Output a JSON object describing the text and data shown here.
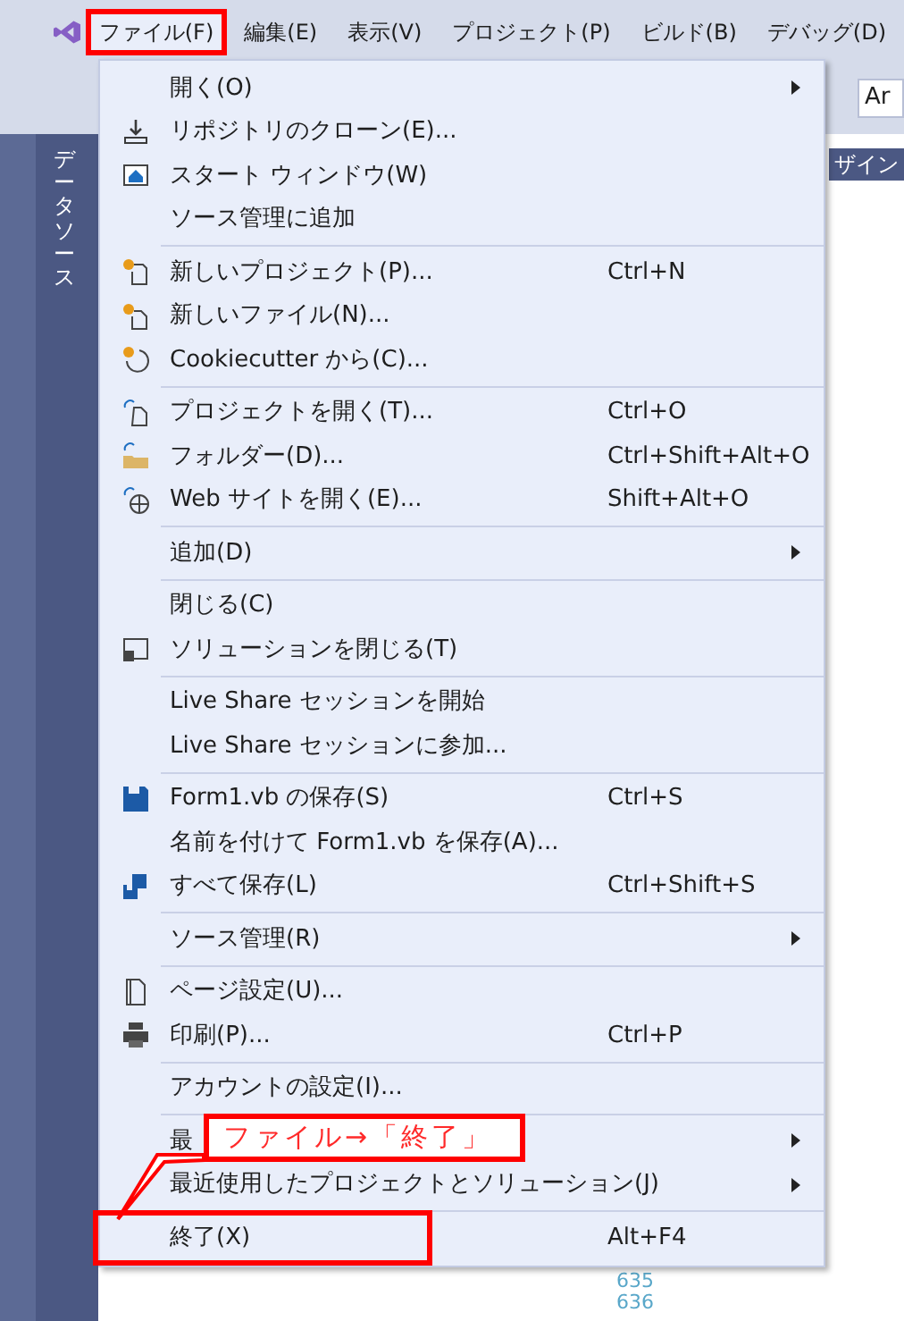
{
  "menubar": [
    {
      "label": "ファイル(F)",
      "highlighted": true
    },
    {
      "label": "編集(E)",
      "highlighted": false
    },
    {
      "label": "表示(V)",
      "highlighted": false
    },
    {
      "label": "プロジェクト(P)",
      "highlighted": false
    },
    {
      "label": "ビルド(B)",
      "highlighted": false
    },
    {
      "label": "デバッグ(D)",
      "highlighted": false
    }
  ],
  "toolbar": {
    "combo_text": "Ar"
  },
  "side_panel": {
    "label": "データソース"
  },
  "designer_tab": {
    "label": "ザイン"
  },
  "line_numbers": [
    "635",
    "636"
  ],
  "file_menu": [
    {
      "kind": "submenu",
      "label": "開く(O)",
      "highlighted": false
    },
    {
      "kind": "item",
      "label": "リポジトリのクローン(E)...",
      "highlighted": false
    },
    {
      "kind": "item",
      "label": "スタート ウィンドウ(W)",
      "highlighted": false
    },
    {
      "kind": "item",
      "label": "ソース管理に追加",
      "highlighted": false
    },
    {
      "kind": "separator"
    },
    {
      "kind": "item",
      "label": "新しいプロジェクト(P)...",
      "shortcut": "Ctrl+N",
      "highlighted": false
    },
    {
      "kind": "item",
      "label": "新しいファイル(N)...",
      "highlighted": false
    },
    {
      "kind": "item",
      "label": "Cookiecutter から(C)...",
      "highlighted": false
    },
    {
      "kind": "separator"
    },
    {
      "kind": "item",
      "label": "プロジェクトを開く(T)...",
      "shortcut": "Ctrl+O",
      "highlighted": false
    },
    {
      "kind": "item",
      "label": "フォルダー(D)...",
      "shortcut": "Ctrl+Shift+Alt+O",
      "highlighted": false
    },
    {
      "kind": "item",
      "label": "Web サイトを開く(E)...",
      "shortcut": "Shift+Alt+O",
      "highlighted": false
    },
    {
      "kind": "separator"
    },
    {
      "kind": "submenu",
      "label": "追加(D)",
      "highlighted": false
    },
    {
      "kind": "separator"
    },
    {
      "kind": "item",
      "label": "閉じる(C)",
      "highlighted": false
    },
    {
      "kind": "item",
      "label": "ソリューションを閉じる(T)",
      "highlighted": false
    },
    {
      "kind": "separator"
    },
    {
      "kind": "item",
      "label": "Live Share セッションを開始",
      "highlighted": false
    },
    {
      "kind": "item",
      "label": "Live Share セッションに参加...",
      "highlighted": false
    },
    {
      "kind": "separator"
    },
    {
      "kind": "item",
      "label": "Form1.vb の保存(S)",
      "shortcut": "Ctrl+S",
      "highlighted": false
    },
    {
      "kind": "item",
      "label": "名前を付けて Form1.vb を保存(A)...",
      "highlighted": false
    },
    {
      "kind": "item",
      "label": "すべて保存(L)",
      "shortcut": "Ctrl+Shift+S",
      "highlighted": false
    },
    {
      "kind": "separator"
    },
    {
      "kind": "submenu",
      "label": "ソース管理(R)",
      "highlighted": false
    },
    {
      "kind": "separator"
    },
    {
      "kind": "item",
      "label": "ページ設定(U)...",
      "highlighted": false
    },
    {
      "kind": "item",
      "label": "印刷(P)...",
      "shortcut": "Ctrl+P",
      "highlighted": false
    },
    {
      "kind": "separator"
    },
    {
      "kind": "item",
      "label": "アカウントの設定(I)...",
      "highlighted": false
    },
    {
      "kind": "separator"
    },
    {
      "kind": "submenu",
      "label": "最",
      "highlighted": false
    },
    {
      "kind": "submenu",
      "label": "最近使用したプロジェクトとソリューション(J)",
      "highlighted": false
    },
    {
      "kind": "separator"
    },
    {
      "kind": "item",
      "label": "終了(X)",
      "shortcut": "Alt+F4",
      "highlighted": true
    }
  ],
  "callout": {
    "text": "ファイル→「終了」"
  }
}
